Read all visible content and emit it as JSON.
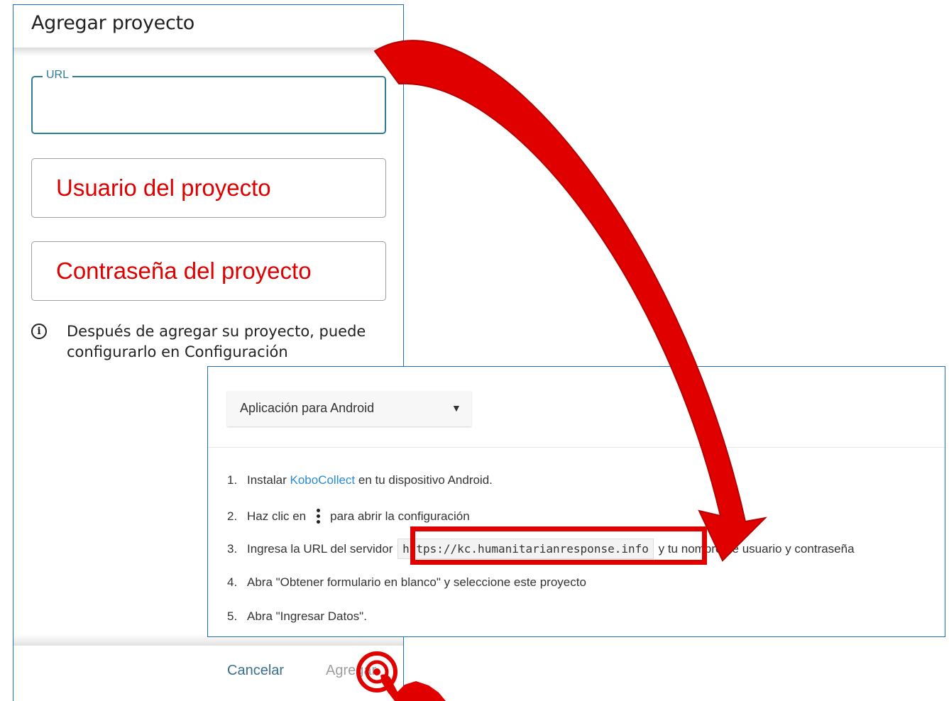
{
  "dialog": {
    "title": "Agregar proyecto",
    "url_label": "URL",
    "url_value": "",
    "user_placeholder": "Usuario del proyecto",
    "password_placeholder": "Contraseña del proyecto",
    "info_text": "Después de agregar su proyecto, puede configurarlo en Configuración",
    "cancel_label": "Cancelar",
    "add_label": "Agregar"
  },
  "panel": {
    "select_value": "Aplicación para Android",
    "steps": {
      "s1": {
        "num": "1.",
        "pre": "Instalar ",
        "link": "KoboCollect",
        "post": " en tu dispositivo Android."
      },
      "s2": {
        "num": "2.",
        "pre": "Haz clic en",
        "post": "para abrir la configuración"
      },
      "s3": {
        "num": "3.",
        "pre": "Ingresa la URL del servidor",
        "code": "https://kc.humanitarianresponse.info",
        "post": "y tu nombre de usuario y contraseña"
      },
      "s4": {
        "num": "4.",
        "text": "Abra \"Obtener formulario en blanco\" y seleccione este proyecto"
      },
      "s5": {
        "num": "5.",
        "text": "Abra \"Ingresar Datos\"."
      }
    }
  },
  "colors": {
    "annotation_red": "#e00000",
    "border_blue": "#1f6fbf",
    "link_blue": "#2a8ad6"
  },
  "icons": [
    "info-icon",
    "dropdown-arrow-icon",
    "kebab-menu-icon",
    "pointer-hand-icon",
    "curved-arrow-icon"
  ]
}
